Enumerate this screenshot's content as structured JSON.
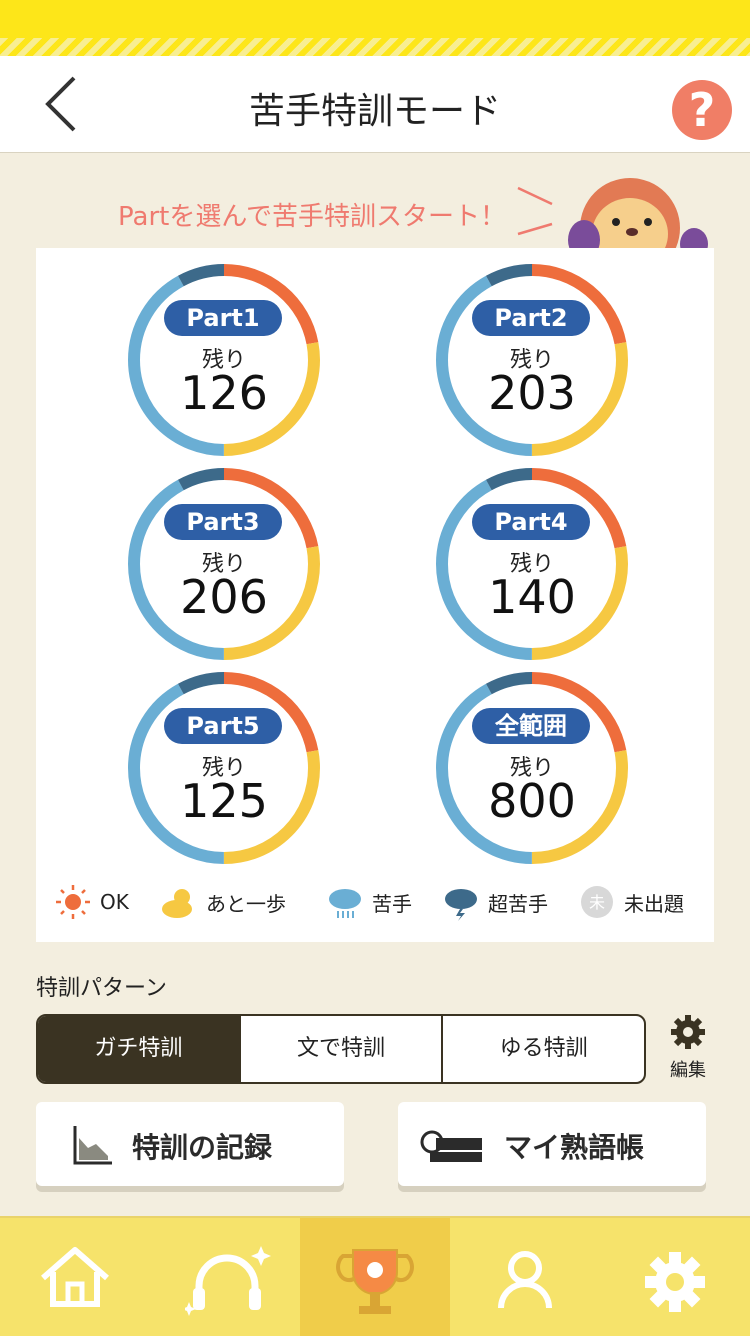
{
  "header": {
    "title": "苦手特訓モード",
    "help_label": "?"
  },
  "banner": {
    "text": "Partを選んで苦手特訓スタート！"
  },
  "parts": [
    {
      "label": "Part1",
      "remaining_label": "残り",
      "remaining": "126"
    },
    {
      "label": "Part2",
      "remaining_label": "残り",
      "remaining": "203"
    },
    {
      "label": "Part3",
      "remaining_label": "残り",
      "remaining": "206"
    },
    {
      "label": "Part4",
      "remaining_label": "残り",
      "remaining": "140"
    },
    {
      "label": "Part5",
      "remaining_label": "残り",
      "remaining": "125"
    },
    {
      "label": "全範囲",
      "remaining_label": "残り",
      "remaining": "800"
    }
  ],
  "legend": [
    {
      "label": "OK",
      "icon": "sun-icon",
      "color": "#ee6d3c"
    },
    {
      "label": "あと一歩",
      "icon": "partly-sunny-icon",
      "color": "#f6c842"
    },
    {
      "label": "苦手",
      "icon": "rain-cloud-icon",
      "color": "#6aaed4"
    },
    {
      "label": "超苦手",
      "icon": "storm-cloud-icon",
      "color": "#3d6a8a"
    },
    {
      "label": "未出題",
      "icon": "unasked-icon",
      "color": "#d8d8d8",
      "icon_text": "未"
    }
  ],
  "pattern": {
    "label": "特訓パターン",
    "options": [
      "ガチ特訓",
      "文で特訓",
      "ゆる特訓"
    ],
    "selected": "ガチ特訓",
    "edit_label": "編集"
  },
  "actions": {
    "record": "特訓の記録",
    "phrasebook": "マイ熟語帳"
  },
  "colors": {
    "ok": "#ee6d3c",
    "almost": "#f6c842",
    "weak": "#6aaed4",
    "very_weak": "#3d6a8a",
    "badge": "#2e5fa6"
  }
}
